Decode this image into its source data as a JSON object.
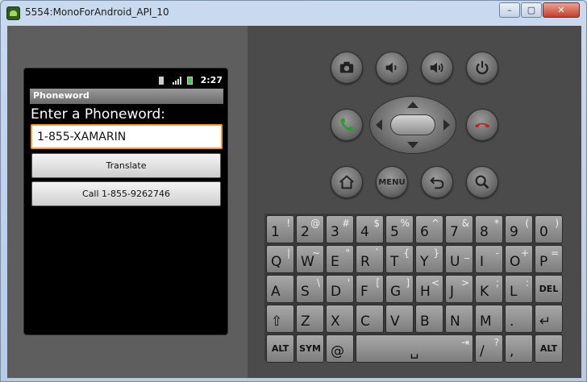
{
  "window": {
    "title": "5554:MonoForAndroid_API_10",
    "minimize_label": "–",
    "maximize_label": "▢",
    "close_label": "✕"
  },
  "statusbar": {
    "time": "2:27"
  },
  "app": {
    "title": "Phoneword",
    "prompt": "Enter a Phoneword:",
    "input_value": "1-855-XAMARIN",
    "translate_label": "Translate",
    "call_label": "Call 1-855-9262746"
  },
  "hardware_buttons": {
    "menu_label": "MENU"
  },
  "keyboard": {
    "rows": [
      [
        {
          "m": "1",
          "a": "!"
        },
        {
          "m": "2",
          "a": "@"
        },
        {
          "m": "3",
          "a": "#"
        },
        {
          "m": "4",
          "a": "$"
        },
        {
          "m": "5",
          "a": "%"
        },
        {
          "m": "6",
          "a": "^"
        },
        {
          "m": "7",
          "a": "&"
        },
        {
          "m": "8",
          "a": "*"
        },
        {
          "m": "9",
          "a": "("
        },
        {
          "m": "0",
          "a": ")"
        }
      ],
      [
        {
          "m": "Q",
          "a": "|"
        },
        {
          "m": "W",
          "a": "~"
        },
        {
          "m": "E",
          "a": "\""
        },
        {
          "m": "R",
          "a": "`"
        },
        {
          "m": "T",
          "a": "{"
        },
        {
          "m": "Y",
          "a": "}"
        },
        {
          "m": "U",
          "a": "_"
        },
        {
          "m": "I",
          "a": "-"
        },
        {
          "m": "O",
          "a": "+"
        },
        {
          "m": "P",
          "a": "="
        }
      ],
      [
        {
          "m": "A",
          "a": ""
        },
        {
          "m": "S",
          "a": "\\"
        },
        {
          "m": "D",
          "a": "'"
        },
        {
          "m": "F",
          "a": "["
        },
        {
          "m": "G",
          "a": "]"
        },
        {
          "m": "H",
          "a": "<"
        },
        {
          "m": "J",
          "a": ">"
        },
        {
          "m": "K",
          "a": ";"
        },
        {
          "m": "L",
          "a": ":"
        },
        {
          "m": "DEL",
          "a": ""
        }
      ],
      [
        {
          "m": "⇧",
          "a": ""
        },
        {
          "m": "Z",
          "a": ""
        },
        {
          "m": "X",
          "a": ""
        },
        {
          "m": "C",
          "a": ""
        },
        {
          "m": "V",
          "a": ""
        },
        {
          "m": "B",
          "a": ""
        },
        {
          "m": "N",
          "a": ""
        },
        {
          "m": "M",
          "a": ""
        },
        {
          "m": ".",
          "a": ""
        },
        {
          "m": "↵",
          "a": ""
        }
      ],
      [
        {
          "m": "ALT",
          "a": ""
        },
        {
          "m": "SYM",
          "a": ""
        },
        {
          "m": "@",
          "a": ""
        },
        {
          "m": "␣",
          "a": "⇥"
        },
        {
          "m": "/",
          "a": "?"
        },
        {
          "m": ",",
          "a": ""
        },
        {
          "m": "ALT",
          "a": ""
        }
      ]
    ]
  },
  "colors": {
    "focus_border": "#ff9a1f",
    "call_green": "#2e9b2e",
    "end_red": "#c62020"
  }
}
